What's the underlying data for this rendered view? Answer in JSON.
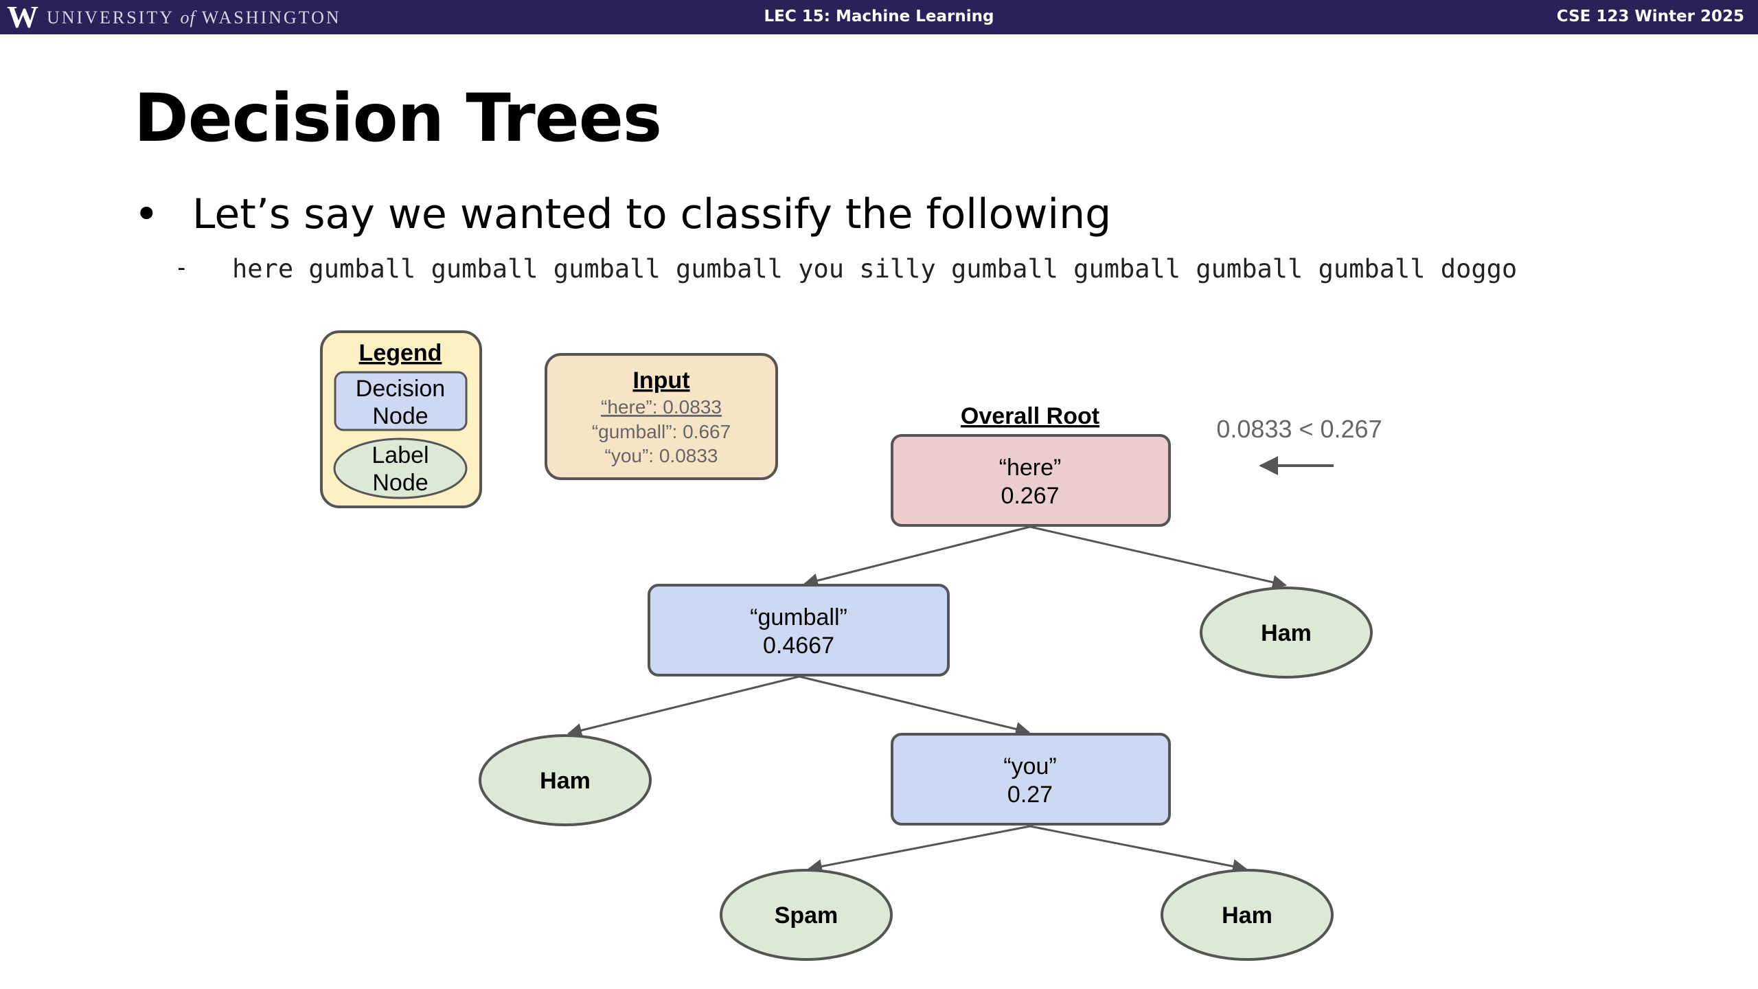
{
  "header": {
    "logo_letter": "W",
    "university_prefix": "UNIVERSITY",
    "university_of": "of",
    "university_suffix": "WASHINGTON",
    "lecture": "LEC 15: Machine Learning",
    "course": "CSE 123 Winter 2025"
  },
  "slide": {
    "title": "Decision Trees",
    "bullet": "Let’s say we wanted to classify the following",
    "sub_bullet": "here gumball gumball gumball gumball you silly gumball gumball gumball gumball doggo"
  },
  "legend": {
    "title": "Legend",
    "decision_line1": "Decision",
    "decision_line2": "Node",
    "label_line1": "Label",
    "label_line2": "Node"
  },
  "input": {
    "title": "Input",
    "lines": [
      "“here”: 0.0833",
      "“gumball”: 0.667",
      "“you”: 0.0833"
    ]
  },
  "annotation": {
    "root_caption": "Overall Root",
    "comparison": "0.0833 < 0.267"
  },
  "tree": {
    "root": {
      "feature": "“here”",
      "threshold": "0.267"
    },
    "root_right": "Ham",
    "gumball": {
      "feature": "“gumball”",
      "threshold": "0.4667"
    },
    "gumball_left": "Ham",
    "you": {
      "feature": "“you”",
      "threshold": "0.27"
    },
    "you_left": "Spam",
    "you_right": "Ham"
  },
  "colors": {
    "header_bg": "#2b2159",
    "root_fill": "#ebcdd0",
    "decision_fill": "#cdd9f2",
    "label_fill": "#dde8d6",
    "legend_fill": "#fcf0c4",
    "input_fill": "#f7e4c6",
    "stroke": "#555555"
  }
}
